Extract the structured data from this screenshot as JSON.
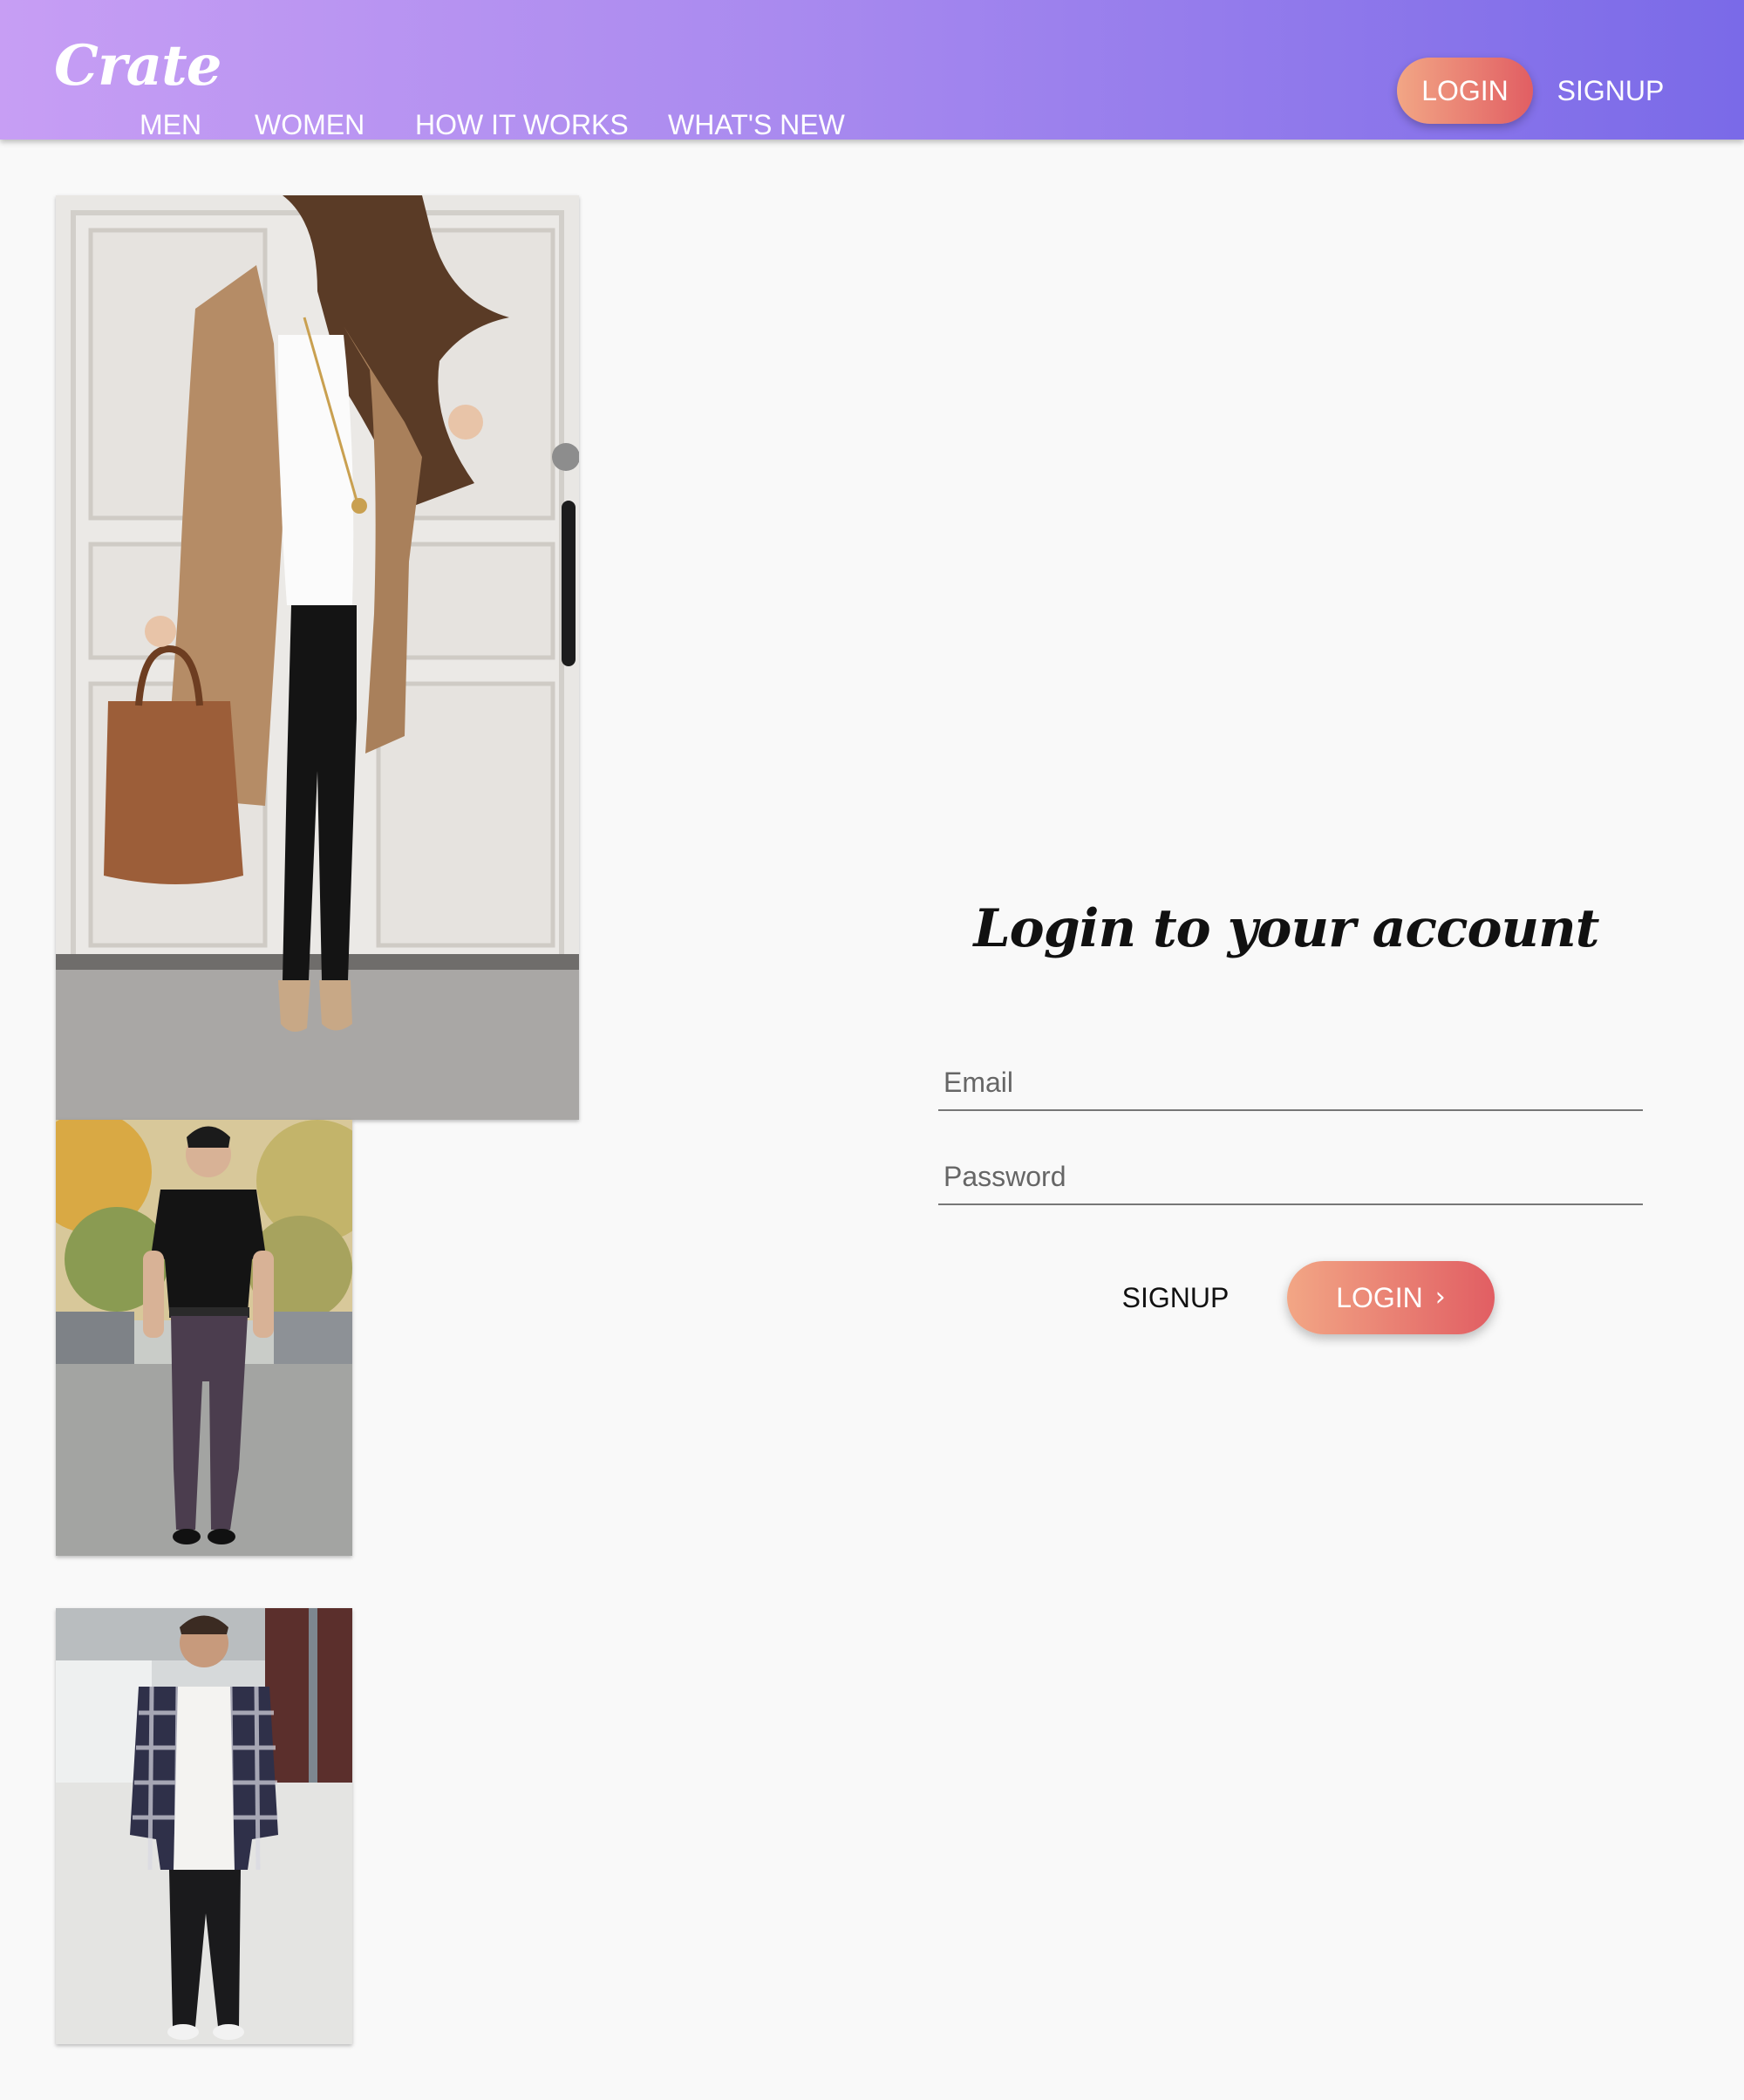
{
  "header": {
    "logo": "Crate",
    "nav": [
      "MEN",
      "WOMEN",
      "HOW IT WORKS",
      "WHAT'S NEW"
    ],
    "login_label": "LOGIN",
    "signup_label": "SIGNUP"
  },
  "form": {
    "title": "Login to your account",
    "email_placeholder": "Email",
    "password_placeholder": "Password",
    "signup_label": "SIGNUP",
    "login_label": "LOGIN",
    "login_icon": "chevron-right-icon"
  },
  "colors": {
    "header_gradient": [
      "#c79ef4",
      "#7a6ae8"
    ],
    "button_gradient": [
      "#f2a685",
      "#e15e63"
    ],
    "background": "#f9f9f9"
  }
}
